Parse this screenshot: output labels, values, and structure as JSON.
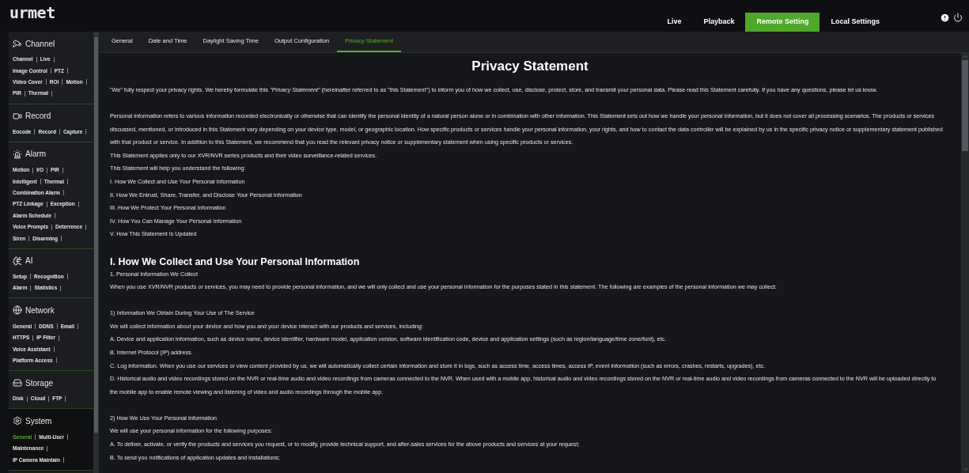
{
  "logo": "urmet",
  "nav": [
    {
      "label": "Live",
      "selected": false
    },
    {
      "label": "Playback",
      "selected": false
    },
    {
      "label": "Remote Setting",
      "selected": true
    },
    {
      "label": "Local Settings",
      "selected": false
    }
  ],
  "sidebar": [
    {
      "title": "Channel",
      "selected": false,
      "links": [
        {
          "label": "Channel",
          "selected": false
        },
        {
          "label": "Live",
          "selected": false
        },
        {
          "label": "Image Control",
          "selected": false
        },
        {
          "label": "PTZ",
          "selected": false
        },
        {
          "label": "Video Cover",
          "selected": false
        },
        {
          "label": "ROI",
          "selected": false
        },
        {
          "label": "Motion",
          "selected": false
        },
        {
          "label": "PIR",
          "selected": false
        },
        {
          "label": "Thermal",
          "selected": false
        }
      ]
    },
    {
      "title": "Record",
      "selected": false,
      "links": [
        {
          "label": "Encode",
          "selected": false
        },
        {
          "label": "Record",
          "selected": false
        },
        {
          "label": "Capture",
          "selected": false
        }
      ]
    },
    {
      "title": "Alarm",
      "selected": false,
      "links": [
        {
          "label": "Motion",
          "selected": false
        },
        {
          "label": "I/O",
          "selected": false
        },
        {
          "label": "PIR",
          "selected": false
        },
        {
          "label": "Intelligent",
          "selected": false
        },
        {
          "label": "Thermal",
          "selected": false
        },
        {
          "label": "Combination Alarm",
          "selected": false
        },
        {
          "label": "PTZ Linkage",
          "selected": false
        },
        {
          "label": "Exception",
          "selected": false
        },
        {
          "label": "Alarm Schedule",
          "selected": false
        },
        {
          "label": "Voice Prompts",
          "selected": false
        },
        {
          "label": "Deterrence",
          "selected": false
        },
        {
          "label": "Siren",
          "selected": false
        },
        {
          "label": "Disarming",
          "selected": false
        }
      ]
    },
    {
      "title": "AI",
      "selected": false,
      "links": [
        {
          "label": "Setup",
          "selected": false
        },
        {
          "label": "Recognition",
          "selected": false
        },
        {
          "label": "Alarm",
          "selected": false
        },
        {
          "label": "Statistics",
          "selected": false
        }
      ]
    },
    {
      "title": "Network",
      "selected": false,
      "links": [
        {
          "label": "General",
          "selected": false
        },
        {
          "label": "DDNS",
          "selected": false
        },
        {
          "label": "Email",
          "selected": false
        },
        {
          "label": "HTTPS",
          "selected": false
        },
        {
          "label": "IP Filter",
          "selected": false
        },
        {
          "label": "Voice Assistant",
          "selected": false
        },
        {
          "label": "Platform Access",
          "selected": false
        }
      ]
    },
    {
      "title": "Storage",
      "selected": false,
      "links": [
        {
          "label": "Disk",
          "selected": false
        },
        {
          "label": "Cloud",
          "selected": false
        },
        {
          "label": "FTP",
          "selected": false
        }
      ]
    },
    {
      "title": "System",
      "selected": true,
      "links": [
        {
          "label": "General",
          "selected": true
        },
        {
          "label": "Multi-User",
          "selected": false
        },
        {
          "label": "Maintenance",
          "selected": false
        },
        {
          "label": "IP Camera Maintain",
          "selected": false
        }
      ]
    }
  ],
  "tabs": [
    {
      "label": "General",
      "selected": false
    },
    {
      "label": "Date and Time",
      "selected": false
    },
    {
      "label": "Daylight Saving Time",
      "selected": false
    },
    {
      "label": "Output Configuration",
      "selected": false
    },
    {
      "label": "Privacy Statement",
      "selected": true
    }
  ],
  "document": {
    "title": "Privacy Statement",
    "blocks": [
      {
        "kind": "paragraph",
        "text": "\"We\" fully respect your privacy rights. We hereby formulate this *\"Privacy Statement\"* (hereinafter referred to as \"this Statement\") to inform you of how we collect, use, disclose, protect, store, and transmit your personal data. Please read this Statement carefully. If you have any questions, please let us know."
      },
      {
        "kind": "blank"
      },
      {
        "kind": "paragraph",
        "text": "Personal information refers to various information recorded electronically or otherwise that can identify the personal identity of a natural person alone or in combination with other information. This Statement sets out how we handle your personal information, but it does not cover all processing scenarios. The products or services discussed, mentioned, or introduced in this Statement vary depending on your device type, model, or geographic location. How specific products or services handle your personal information, your rights, and how to contact the data controller will be explained by us in the specific privacy notice or supplementary statement published with that product or service. In addition to this Statement, we recommend that you read the relevant privacy notice or supplementary statement when using specific products or services."
      },
      {
        "kind": "paragraph",
        "text": "This Statement applies only to our XVR/NVR series products and their video surveillance-related services."
      },
      {
        "kind": "paragraph",
        "text": "This Statement will help you understand the following:"
      },
      {
        "kind": "paragraph",
        "text": "I. How We Collect and Use Your Personal Information"
      },
      {
        "kind": "paragraph",
        "text": "II. How We Entrust, Share, Transfer, and Disclose Your Personal Information"
      },
      {
        "kind": "paragraph",
        "text": "III. How We Protect Your Personal Information"
      },
      {
        "kind": "paragraph",
        "text": "IV. How You Can Manage Your Personal Information"
      },
      {
        "kind": "paragraph",
        "text": "V. How This Statement Is Updated"
      },
      {
        "kind": "blank"
      },
      {
        "kind": "heading",
        "text": "I. How We Collect and Use Your Personal Information"
      },
      {
        "kind": "paragraph",
        "text": "1. Personal Information We Collect"
      },
      {
        "kind": "paragraph",
        "text": "When you use XVR/NVR products or services, you may need to provide personal information, and we will only collect and use your personal information for the purposes stated in this statement. The following are examples of the personal information we may collect:"
      },
      {
        "kind": "blank"
      },
      {
        "kind": "paragraph",
        "text": "1) Information We Obtain During Your Use of The Service"
      },
      {
        "kind": "paragraph",
        "text": "We will collect information about your device and how you and your device interact with our products and services, including:"
      },
      {
        "kind": "paragraph",
        "text": "A. Device and application information, such as device name, device identifier, hardware model, application version, software identification code, device and application settings (such as region/language/time zone/font), etc."
      },
      {
        "kind": "paragraph",
        "text": "B. Internet Protocol (IP) address."
      },
      {
        "kind": "paragraph",
        "text": "C. Log information. When you use our services or view content provided by us, we will automatically collect certain information and store it in logs, such as access time, access times, access IP, event information (such as errors, crashes, restarts, upgrades), etc."
      },
      {
        "kind": "paragraph",
        "text": "D. Historical audio and video recordings stored on the NVR or real-time audio and video recordings from cameras connected to the NVR. When used with a mobile app, historical audio and video recordings stored on the NVR or real-time audio and video recordings from cameras connected to the NVR will be uploaded directly to the mobile app to enable remote viewing and listening of video and audio recordings through the mobile app."
      },
      {
        "kind": "blank"
      },
      {
        "kind": "paragraph",
        "text": "2) How We Use Your Personal Information"
      },
      {
        "kind": "paragraph",
        "text": "We will use your personal information for the following purposes:"
      },
      {
        "kind": "paragraph",
        "text": "A. To deliver, activate, or verify the products and services you request, or to modify, provide technical support, and after-sales services for the above products and services at your request;"
      },
      {
        "kind": "paragraph",
        "text": "B. To send you notifications of application updates and installations;"
      }
    ]
  }
}
